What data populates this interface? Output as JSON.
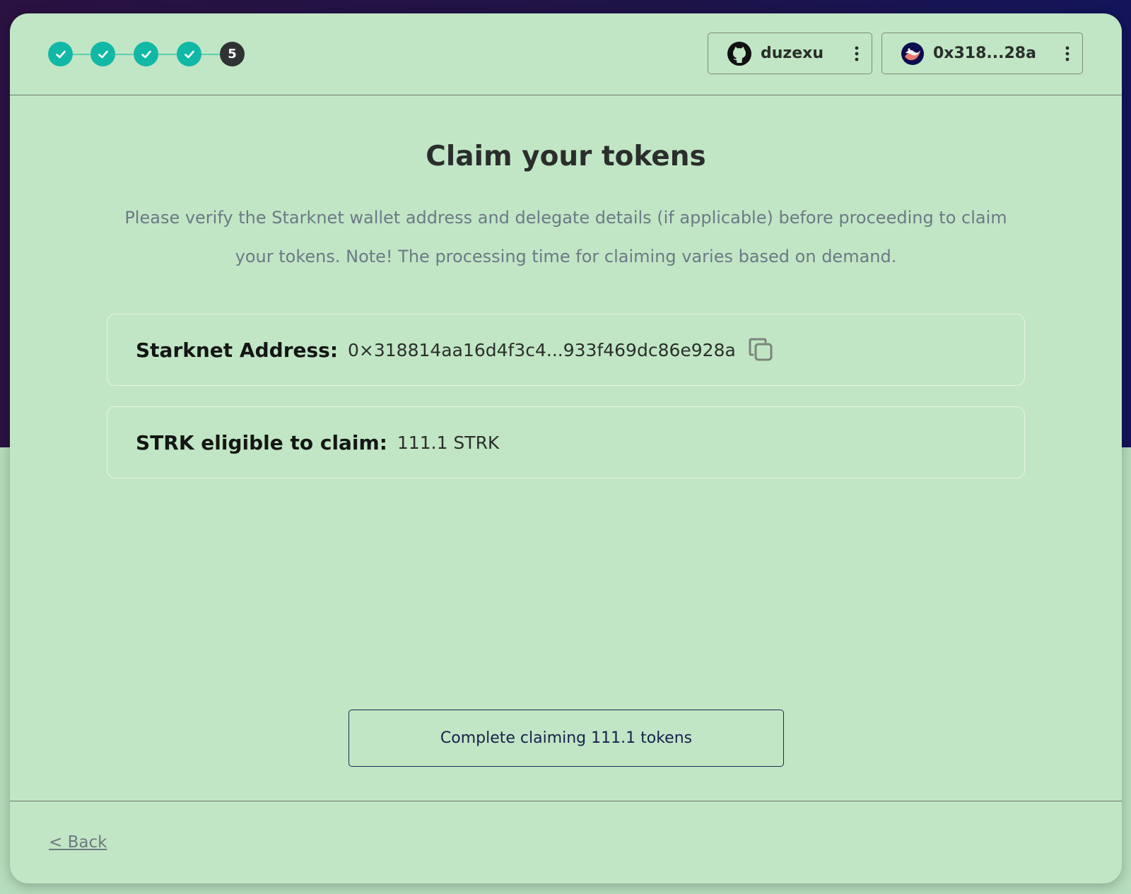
{
  "stepper": {
    "steps": [
      {
        "state": "done",
        "icon": "check-icon"
      },
      {
        "state": "done",
        "icon": "check-icon"
      },
      {
        "state": "done",
        "icon": "check-icon"
      },
      {
        "state": "done",
        "icon": "check-icon"
      },
      {
        "state": "current",
        "label": "5"
      }
    ]
  },
  "header": {
    "github": {
      "icon": "github-icon",
      "username": "duzexu",
      "menu_icon": "kebab-menu-icon"
    },
    "wallet": {
      "icon": "starknet-logo-icon",
      "address_short": "0x318...28a",
      "menu_icon": "kebab-menu-icon"
    }
  },
  "main": {
    "title": "Claim your tokens",
    "subtitle": "Please verify the Starknet wallet address and delegate details (if applicable) before proceeding to claim your tokens. Note! The processing time for claiming varies based on demand.",
    "address_label": "Starknet Address:",
    "address_value": "0×318814aa16d4f3c4...933f469dc86e928a",
    "eligible_label": "STRK eligible to claim:",
    "eligible_value": "111.1 STRK",
    "claim_button": "Complete claiming 111.1 tokens"
  },
  "footer": {
    "back_label": "< Back"
  },
  "colors": {
    "card_bg": "#c1e6c5",
    "step_done": "#12b8a6",
    "step_current": "#2f3333",
    "button_border": "#1d2a55"
  }
}
